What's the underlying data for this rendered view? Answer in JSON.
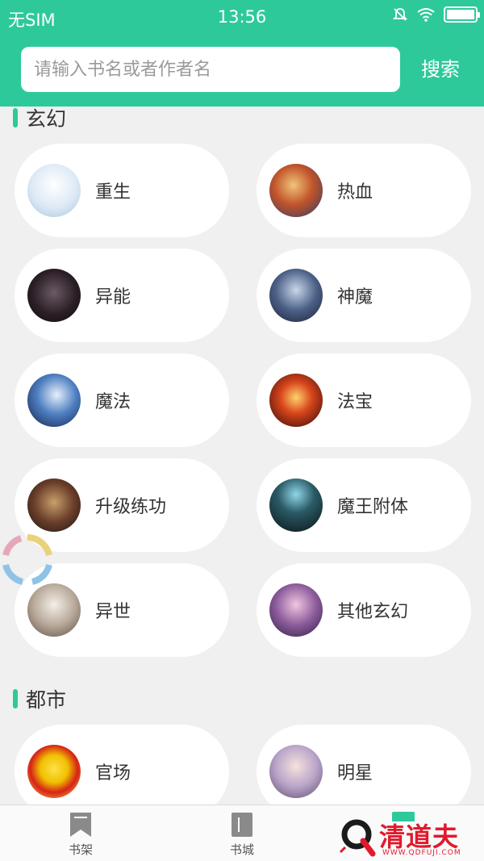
{
  "status_bar": {
    "carrier": "无SIM",
    "time": "13:56"
  },
  "search": {
    "placeholder": "请输入书名或者作者名",
    "button_label": "搜索"
  },
  "sections": [
    {
      "title": "玄幻",
      "items": [
        {
          "label": "重生",
          "avatar": "avatar-girl-white-dress"
        },
        {
          "label": "热血",
          "avatar": "avatar-warrior-fire"
        },
        {
          "label": "异能",
          "avatar": "avatar-dark-knight"
        },
        {
          "label": "神魔",
          "avatar": "avatar-dark-hair-swordsman"
        },
        {
          "label": "魔法",
          "avatar": "avatar-mage-blue"
        },
        {
          "label": "法宝",
          "avatar": "avatar-fire-flower"
        },
        {
          "label": "升级练功",
          "avatar": "avatar-armored-warriors"
        },
        {
          "label": "魔王附体",
          "avatar": "avatar-demon-king"
        },
        {
          "label": "异世",
          "avatar": "avatar-white-hair-hero"
        },
        {
          "label": "其他玄幻",
          "avatar": "avatar-fantasy-swordsman"
        }
      ]
    },
    {
      "title": "都市",
      "items": [
        {
          "label": "官场",
          "avatar": "avatar-red-hat"
        },
        {
          "label": "明星",
          "avatar": "avatar-star-woman"
        }
      ]
    }
  ],
  "tabs": [
    {
      "label": "书架",
      "icon": "bookmark-icon"
    },
    {
      "label": "书城",
      "icon": "book-icon"
    }
  ],
  "watermark": {
    "text": "清道夫",
    "url": "WWW.QDFUJI.COM"
  },
  "colors": {
    "primary": "#2ec99a",
    "background": "#f0f0f0",
    "watermark": "#e2192c"
  }
}
